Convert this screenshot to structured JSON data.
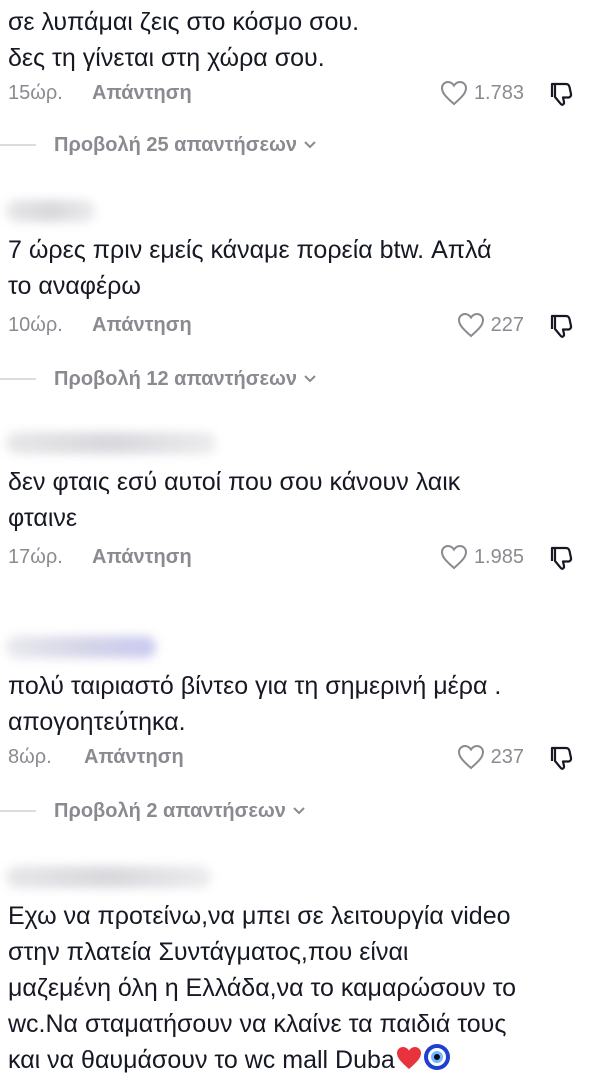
{
  "comments": [
    {
      "text": "σε λυπάμαι ζεις στο κόσμο σου.\nδες τη γίνεται στη χώρα σου.",
      "time": "15ώρ.",
      "reply": "Απάντηση",
      "likes": "1.783",
      "replies": "Προβολή 25 απαντήσεων"
    },
    {
      "text": "7 ώρες πριν εμείς κάναμε πορεία btw. Απλά\nτο αναφέρω",
      "time": "10ώρ.",
      "reply": "Απάντηση",
      "likes": "227",
      "replies": "Προβολή 12 απαντήσεων"
    },
    {
      "text": "δεν φταις εσύ αυτοί που σου κάνουν λαικ\nφταινε",
      "time": "17ώρ.",
      "reply": "Απάντηση",
      "likes": "1.985",
      "replies": ""
    },
    {
      "text": "πολύ ταιριαστό βίντεο για τη σημερινή μέρα .\nαπογοητεύτηκα.",
      "time": "8ώρ.",
      "reply": "Απάντηση",
      "likes": "237",
      "replies": "Προβολή 2 απαντήσεων"
    },
    {
      "text": "Εχω να προτείνω,να μπει σε λειτουργία video\nστην πλατεία Συντάγματος,που είναι\nμαζεμένη όλη η Ελλάδα,να το καμαρώσουν το\nwc.Να σταματήσουν να κλαίνε τα παιδιά τους\nκαι να θαυμάσουν το wc mall Duba",
      "emojis": [
        "red-heart-icon",
        "nazar-amulet-icon"
      ]
    }
  ],
  "colors": {
    "text": "#161823",
    "muted": "#8a8b91",
    "heart_emoji": "#e8323c",
    "nazar": "#1e3fd0"
  }
}
